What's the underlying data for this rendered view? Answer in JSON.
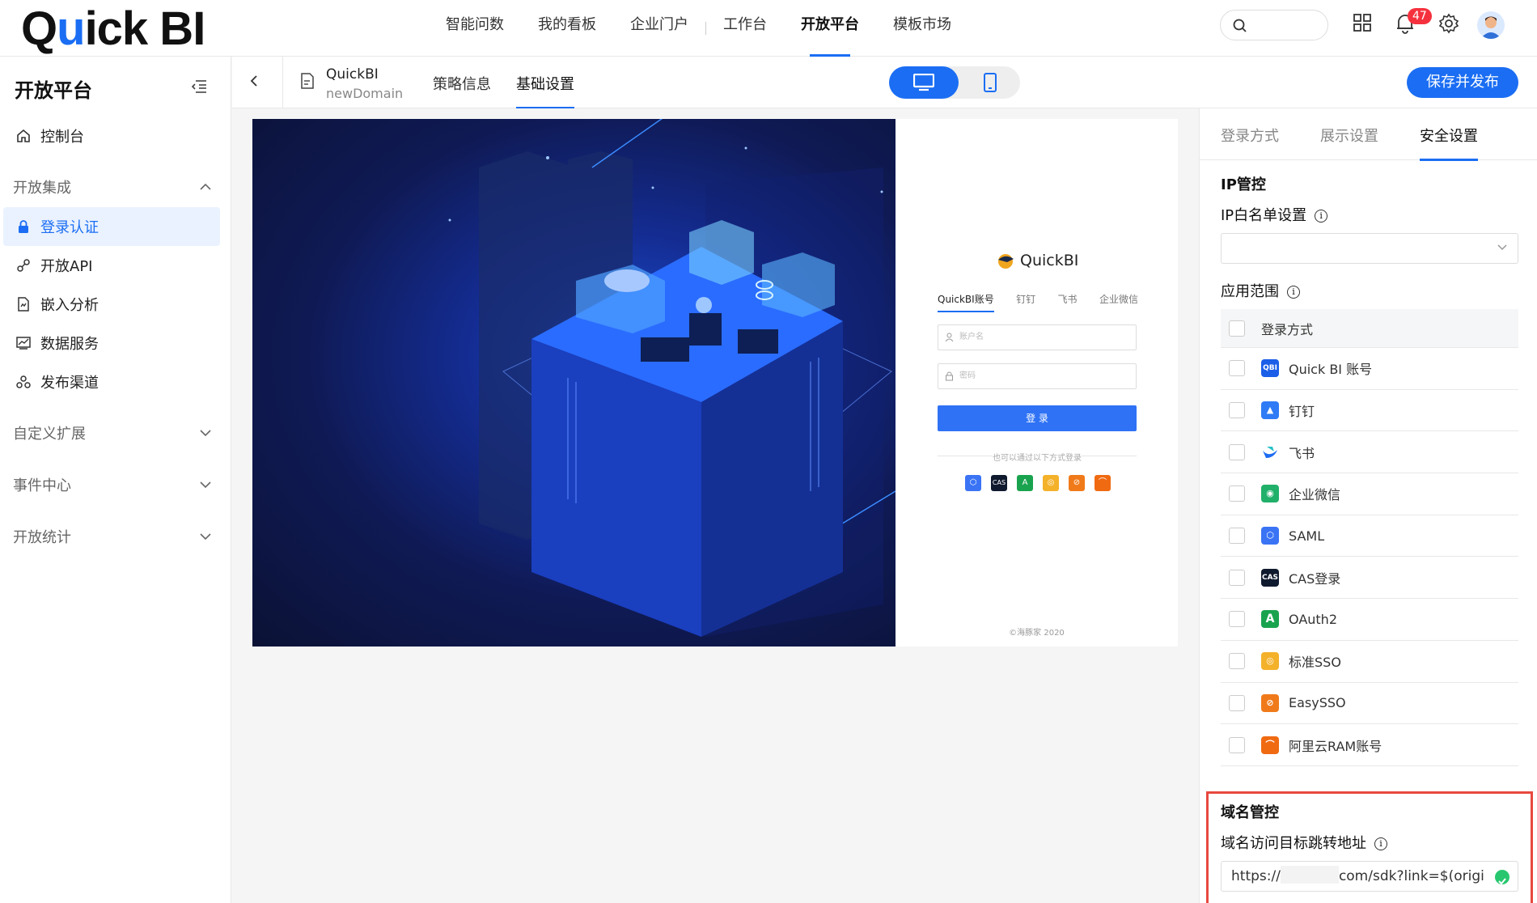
{
  "top": {
    "logo": "Quick BI",
    "nav": [
      "智能问数",
      "我的看板",
      "企业门户",
      "工作台",
      "开放平台",
      "模板市场"
    ],
    "notification_count": "47"
  },
  "sidebar": {
    "title": "开放平台",
    "items": [
      {
        "label": "控制台",
        "icon": "home-icon"
      },
      {
        "label": "开放集成",
        "group": true
      },
      {
        "label": "登录认证",
        "icon": "lock-icon",
        "active": true
      },
      {
        "label": "开放API",
        "icon": "api-icon"
      },
      {
        "label": "嵌入分析",
        "icon": "embed-icon"
      },
      {
        "label": "数据服务",
        "icon": "chart-icon"
      },
      {
        "label": "发布渠道",
        "icon": "channel-icon"
      }
    ],
    "groups": [
      "自定义扩展",
      "事件中心",
      "开放统计"
    ]
  },
  "subbar": {
    "app_name": "QuickBI",
    "app_domain": "newDomain",
    "tabs": [
      "策略信息",
      "基础设置"
    ],
    "publish": "保存并发布"
  },
  "login_preview": {
    "brand": "QuickBI",
    "tabs": [
      "QuickBI账号",
      "钉钉",
      "飞书",
      "企业微信"
    ],
    "username_placeholder": "账户名",
    "password_placeholder": "密码",
    "login_button": "登 录",
    "alt_text": "也可以通过以下方式登录",
    "footer": "©海豚家 2020"
  },
  "right_panel": {
    "tabs": [
      "登录方式",
      "展示设置",
      "安全设置"
    ],
    "ip_section": "IP管控",
    "ip_whitelist": "IP白名单设置",
    "scope": "应用范围",
    "table_header": "登录方式",
    "methods": [
      {
        "label": "Quick BI 账号",
        "color": "#1b5ee8",
        "icon": "QBI"
      },
      {
        "label": "钉钉",
        "color": "#2f7bf6",
        "icon": "▲"
      },
      {
        "label": "飞书",
        "color": "#ffffff",
        "icon": "飞"
      },
      {
        "label": "企业微信",
        "color": "#21b06a",
        "icon": "◉"
      },
      {
        "label": "SAML",
        "color": "#3a74f5",
        "icon": "⬡"
      },
      {
        "label": "CAS登录",
        "color": "#0f1a2e",
        "icon": "CAS"
      },
      {
        "label": "OAuth2",
        "color": "#1aa34f",
        "icon": "A"
      },
      {
        "label": "标准SSO",
        "color": "#f4b12a",
        "icon": "◎"
      },
      {
        "label": "EasySSO",
        "color": "#f07a1a",
        "icon": "⊘"
      },
      {
        "label": "阿里云RAM账号",
        "color": "#f06a12",
        "icon": "⌒"
      }
    ],
    "domain_section": "域名管控",
    "domain_label": "域名访问目标跳转地址",
    "domain_prefix": "https://",
    "domain_suffix": "com/sdk?link=$(origi"
  }
}
